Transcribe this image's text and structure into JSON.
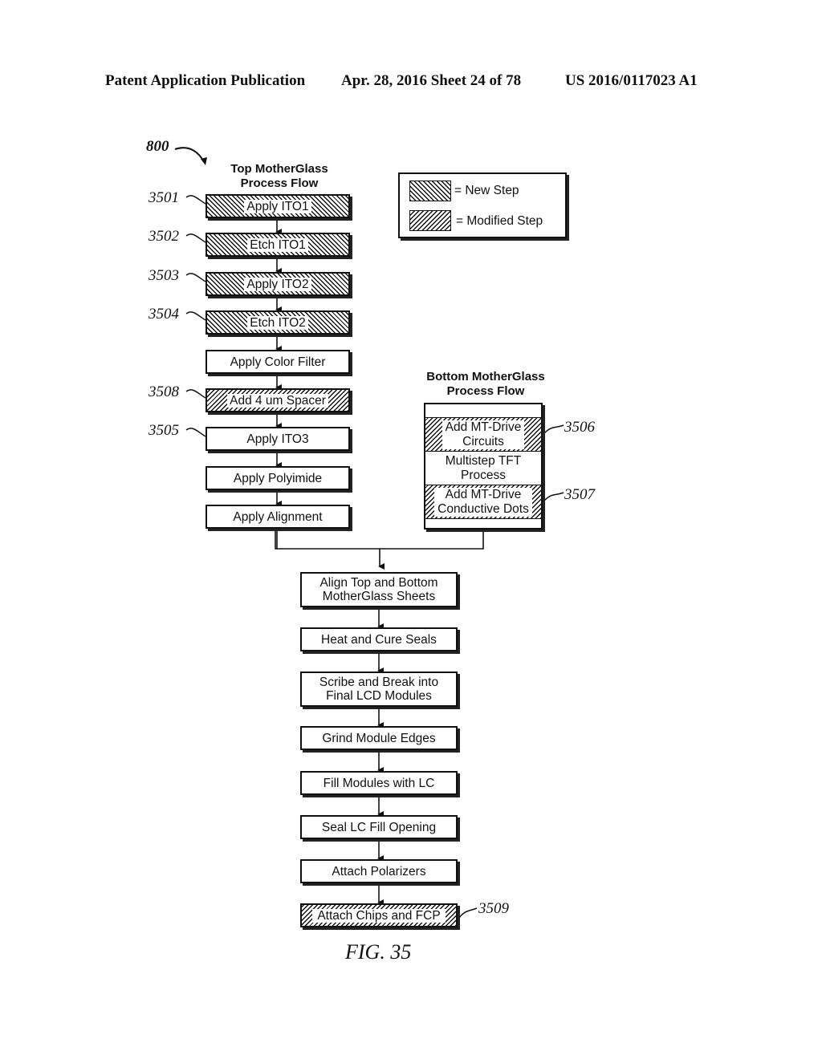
{
  "header": {
    "publication": "Patent Application Publication",
    "date_sheet": "Apr. 28, 2016  Sheet 24 of 78",
    "number": "US 2016/0117023 A1"
  },
  "figure": {
    "ref": "800",
    "caption": "FIG. 35"
  },
  "legend": {
    "new_step": "= New Step",
    "modified_step": "= Modified Step"
  },
  "top_flow": {
    "title_line1": "Top MotherGlass",
    "title_line2": "Process Flow",
    "steps": [
      {
        "label": "Apply ITO1",
        "ref": "3501",
        "type": "new"
      },
      {
        "label": "Etch ITO1",
        "ref": "3502",
        "type": "new"
      },
      {
        "label": "Apply ITO2",
        "ref": "3503",
        "type": "new"
      },
      {
        "label": "Etch ITO2",
        "ref": "3504",
        "type": "new"
      },
      {
        "label": "Apply Color Filter",
        "ref": "",
        "type": "normal"
      },
      {
        "label": "Add 4 um Spacer",
        "ref": "3508",
        "type": "modified"
      },
      {
        "label": "Apply ITO3",
        "ref": "3505",
        "type": "normal"
      },
      {
        "label": "Apply Polyimide",
        "ref": "",
        "type": "normal"
      },
      {
        "label": "Apply Alignment",
        "ref": "",
        "type": "normal"
      }
    ]
  },
  "bottom_flow": {
    "title_line1": "Bottom MotherGlass",
    "title_line2": "Process Flow",
    "steps": [
      {
        "line1": "Add MT-Drive",
        "line2": "Circuits",
        "ref": "3506",
        "type": "modified"
      },
      {
        "line1": "Multistep TFT",
        "line2": "Process",
        "ref": "",
        "type": "normal"
      },
      {
        "line1": "Add MT-Drive",
        "line2": "Conductive Dots",
        "ref": "3507",
        "type": "modified"
      }
    ]
  },
  "merged_flow": {
    "steps": [
      {
        "line1": "Align Top and Bottom",
        "line2": "MotherGlass Sheets",
        "ref": "",
        "type": "normal"
      },
      {
        "line1": "Heat and Cure Seals",
        "line2": "",
        "ref": "",
        "type": "normal"
      },
      {
        "line1": "Scribe and Break into",
        "line2": "Final LCD Modules",
        "ref": "",
        "type": "normal"
      },
      {
        "line1": "Grind Module Edges",
        "line2": "",
        "ref": "",
        "type": "normal"
      },
      {
        "line1": "Fill Modules with LC",
        "line2": "",
        "ref": "",
        "type": "normal"
      },
      {
        "line1": "Seal LC Fill Opening",
        "line2": "",
        "ref": "",
        "type": "normal"
      },
      {
        "line1": "Attach Polarizers",
        "line2": "",
        "ref": "",
        "type": "normal"
      },
      {
        "line1": "Attach Chips and FCP",
        "line2": "",
        "ref": "3509",
        "type": "modified"
      }
    ]
  }
}
